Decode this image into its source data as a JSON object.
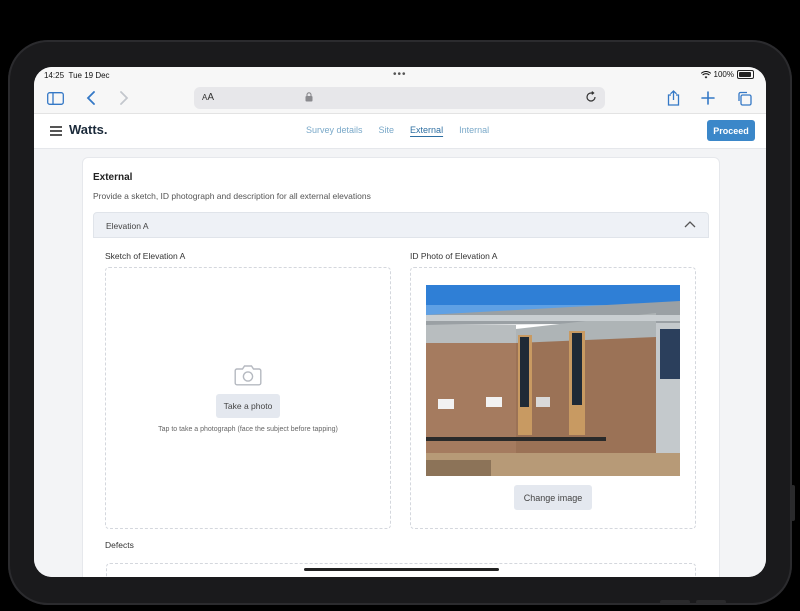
{
  "status": {
    "time": "14:25",
    "date": "Tue 19 Dec",
    "battery": "100%"
  },
  "browser": {
    "aa_label": "AA"
  },
  "app": {
    "logo": "Watts.",
    "nav": [
      {
        "label": "Survey details",
        "active": false
      },
      {
        "label": "Site",
        "active": false
      },
      {
        "label": "External",
        "active": true
      },
      {
        "label": "Internal",
        "active": false
      }
    ],
    "proceed_label": "Proceed"
  },
  "external": {
    "title": "External",
    "description": "Provide a sketch, ID photograph and description for all external elevations",
    "elevation": {
      "title": "Elevation A",
      "sketch_label": "Sketch of Elevation A",
      "take_photo_label": "Take a photo",
      "hint": "Tap to take a photograph (face the subject before tapping)",
      "photo_label": "ID Photo of Elevation A",
      "change_image_label": "Change image"
    },
    "defects_label": "Defects"
  },
  "colors": {
    "accent": "#3b87c9",
    "nav_inactive": "#7aa9c9",
    "nav_active": "#2e6fa2"
  },
  "icons": [
    "sidebar-icon",
    "back-chevron-icon",
    "forward-chevron-icon",
    "lock-icon",
    "reload-icon",
    "share-icon",
    "plus-icon",
    "tabs-icon",
    "hamburger-icon",
    "chevron-up-icon",
    "camera-icon",
    "wifi-icon",
    "battery-icon"
  ]
}
